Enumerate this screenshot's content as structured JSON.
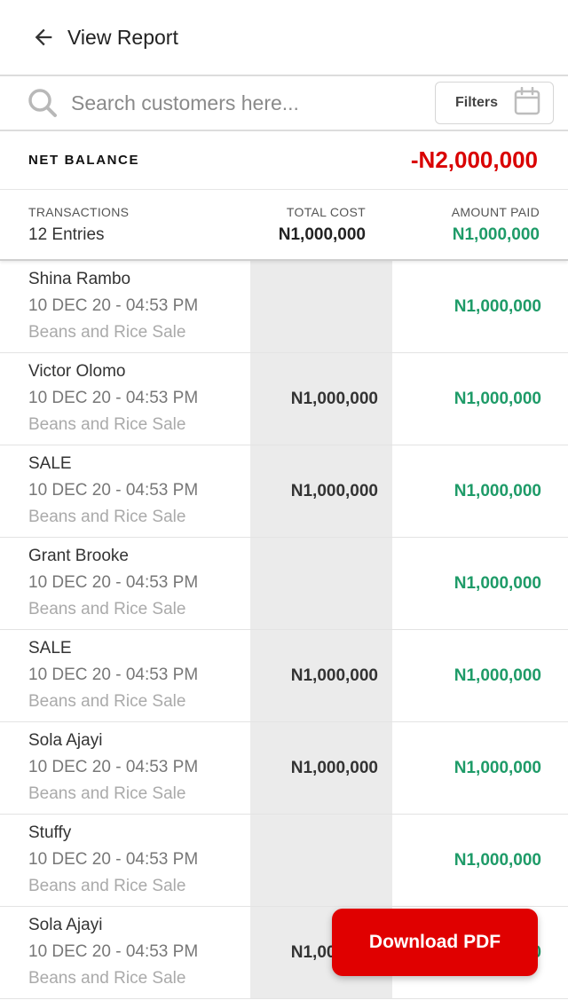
{
  "header": {
    "title": "View Report",
    "back_icon": "arrow-left-icon"
  },
  "search": {
    "placeholder": "Search customers here...",
    "value": "",
    "icon": "search-icon"
  },
  "filters": {
    "label": "Filters",
    "icon": "calendar-icon"
  },
  "net_balance": {
    "label": "NET BALANCE",
    "value": "-N2,000,000",
    "color": "#d90000"
  },
  "summary": {
    "transactions_label": "TRANSACTIONS",
    "transactions_value": "12 Entries",
    "total_cost_label": "TOTAL COST",
    "total_cost_value": "N1,000,000",
    "amount_paid_label": "AMOUNT PAID",
    "amount_paid_value": "N1,000,000",
    "paid_color": "#1e9b68"
  },
  "rows": [
    {
      "name": "Shina Rambo",
      "date": "10 DEC 20 - 04:53 PM",
      "desc": "Beans and Rice Sale",
      "cost": "",
      "paid": "N1,000,000"
    },
    {
      "name": "Victor Olomo",
      "date": "10 DEC 20 - 04:53 PM",
      "desc": "Beans and Rice Sale",
      "cost": "N1,000,000",
      "paid": "N1,000,000"
    },
    {
      "name": "SALE",
      "date": "10 DEC 20 - 04:53 PM",
      "desc": "Beans and Rice Sale",
      "cost": "N1,000,000",
      "paid": "N1,000,000"
    },
    {
      "name": "Grant Brooke",
      "date": "10 DEC 20 - 04:53 PM",
      "desc": "Beans and Rice Sale",
      "cost": "",
      "paid": "N1,000,000"
    },
    {
      "name": "SALE",
      "date": "10 DEC 20 - 04:53 PM",
      "desc": "Beans and Rice Sale",
      "cost": "N1,000,000",
      "paid": "N1,000,000"
    },
    {
      "name": "Sola Ajayi",
      "date": "10 DEC 20 - 04:53 PM",
      "desc": "Beans and Rice Sale",
      "cost": "N1,000,000",
      "paid": "N1,000,000"
    },
    {
      "name": "Stuffy",
      "date": "10 DEC 20 - 04:53 PM",
      "desc": "Beans and Rice Sale",
      "cost": "",
      "paid": "N1,000,000"
    },
    {
      "name": "Sola Ajayi",
      "date": "10 DEC 20 - 04:53 PM",
      "desc": "Beans and Rice Sale",
      "cost": "N1,000,000",
      "paid": "N1,000,000"
    }
  ],
  "download": {
    "label": "Download PDF",
    "color": "#e00000"
  }
}
